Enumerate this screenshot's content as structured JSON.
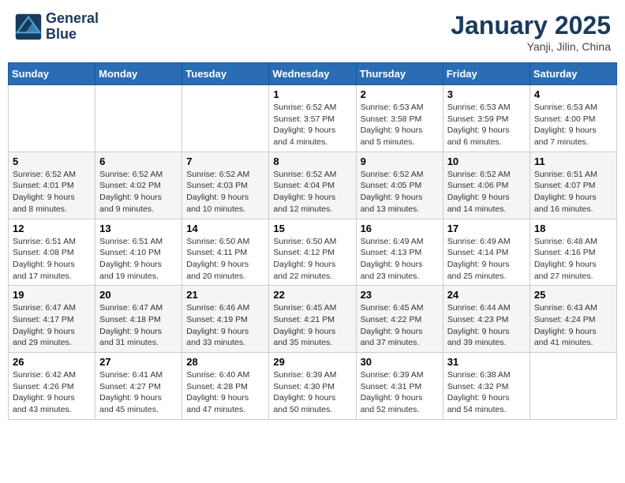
{
  "header": {
    "logo_line1": "General",
    "logo_line2": "Blue",
    "month": "January 2025",
    "location": "Yanji, Jilin, China"
  },
  "weekdays": [
    "Sunday",
    "Monday",
    "Tuesday",
    "Wednesday",
    "Thursday",
    "Friday",
    "Saturday"
  ],
  "weeks": [
    [
      {
        "day": "",
        "info": ""
      },
      {
        "day": "",
        "info": ""
      },
      {
        "day": "",
        "info": ""
      },
      {
        "day": "1",
        "info": "Sunrise: 6:52 AM\nSunset: 3:57 PM\nDaylight: 9 hours and 4 minutes."
      },
      {
        "day": "2",
        "info": "Sunrise: 6:53 AM\nSunset: 3:58 PM\nDaylight: 9 hours and 5 minutes."
      },
      {
        "day": "3",
        "info": "Sunrise: 6:53 AM\nSunset: 3:59 PM\nDaylight: 9 hours and 6 minutes."
      },
      {
        "day": "4",
        "info": "Sunrise: 6:53 AM\nSunset: 4:00 PM\nDaylight: 9 hours and 7 minutes."
      }
    ],
    [
      {
        "day": "5",
        "info": "Sunrise: 6:52 AM\nSunset: 4:01 PM\nDaylight: 9 hours and 8 minutes."
      },
      {
        "day": "6",
        "info": "Sunrise: 6:52 AM\nSunset: 4:02 PM\nDaylight: 9 hours and 9 minutes."
      },
      {
        "day": "7",
        "info": "Sunrise: 6:52 AM\nSunset: 4:03 PM\nDaylight: 9 hours and 10 minutes."
      },
      {
        "day": "8",
        "info": "Sunrise: 6:52 AM\nSunset: 4:04 PM\nDaylight: 9 hours and 12 minutes."
      },
      {
        "day": "9",
        "info": "Sunrise: 6:52 AM\nSunset: 4:05 PM\nDaylight: 9 hours and 13 minutes."
      },
      {
        "day": "10",
        "info": "Sunrise: 6:52 AM\nSunset: 4:06 PM\nDaylight: 9 hours and 14 minutes."
      },
      {
        "day": "11",
        "info": "Sunrise: 6:51 AM\nSunset: 4:07 PM\nDaylight: 9 hours and 16 minutes."
      }
    ],
    [
      {
        "day": "12",
        "info": "Sunrise: 6:51 AM\nSunset: 4:08 PM\nDaylight: 9 hours and 17 minutes."
      },
      {
        "day": "13",
        "info": "Sunrise: 6:51 AM\nSunset: 4:10 PM\nDaylight: 9 hours and 19 minutes."
      },
      {
        "day": "14",
        "info": "Sunrise: 6:50 AM\nSunset: 4:11 PM\nDaylight: 9 hours and 20 minutes."
      },
      {
        "day": "15",
        "info": "Sunrise: 6:50 AM\nSunset: 4:12 PM\nDaylight: 9 hours and 22 minutes."
      },
      {
        "day": "16",
        "info": "Sunrise: 6:49 AM\nSunset: 4:13 PM\nDaylight: 9 hours and 23 minutes."
      },
      {
        "day": "17",
        "info": "Sunrise: 6:49 AM\nSunset: 4:14 PM\nDaylight: 9 hours and 25 minutes."
      },
      {
        "day": "18",
        "info": "Sunrise: 6:48 AM\nSunset: 4:16 PM\nDaylight: 9 hours and 27 minutes."
      }
    ],
    [
      {
        "day": "19",
        "info": "Sunrise: 6:47 AM\nSunset: 4:17 PM\nDaylight: 9 hours and 29 minutes."
      },
      {
        "day": "20",
        "info": "Sunrise: 6:47 AM\nSunset: 4:18 PM\nDaylight: 9 hours and 31 minutes."
      },
      {
        "day": "21",
        "info": "Sunrise: 6:46 AM\nSunset: 4:19 PM\nDaylight: 9 hours and 33 minutes."
      },
      {
        "day": "22",
        "info": "Sunrise: 6:45 AM\nSunset: 4:21 PM\nDaylight: 9 hours and 35 minutes."
      },
      {
        "day": "23",
        "info": "Sunrise: 6:45 AM\nSunset: 4:22 PM\nDaylight: 9 hours and 37 minutes."
      },
      {
        "day": "24",
        "info": "Sunrise: 6:44 AM\nSunset: 4:23 PM\nDaylight: 9 hours and 39 minutes."
      },
      {
        "day": "25",
        "info": "Sunrise: 6:43 AM\nSunset: 4:24 PM\nDaylight: 9 hours and 41 minutes."
      }
    ],
    [
      {
        "day": "26",
        "info": "Sunrise: 6:42 AM\nSunset: 4:26 PM\nDaylight: 9 hours and 43 minutes."
      },
      {
        "day": "27",
        "info": "Sunrise: 6:41 AM\nSunset: 4:27 PM\nDaylight: 9 hours and 45 minutes."
      },
      {
        "day": "28",
        "info": "Sunrise: 6:40 AM\nSunset: 4:28 PM\nDaylight: 9 hours and 47 minutes."
      },
      {
        "day": "29",
        "info": "Sunrise: 6:39 AM\nSunset: 4:30 PM\nDaylight: 9 hours and 50 minutes."
      },
      {
        "day": "30",
        "info": "Sunrise: 6:39 AM\nSunset: 4:31 PM\nDaylight: 9 hours and 52 minutes."
      },
      {
        "day": "31",
        "info": "Sunrise: 6:38 AM\nSunset: 4:32 PM\nDaylight: 9 hours and 54 minutes."
      },
      {
        "day": "",
        "info": ""
      }
    ]
  ]
}
